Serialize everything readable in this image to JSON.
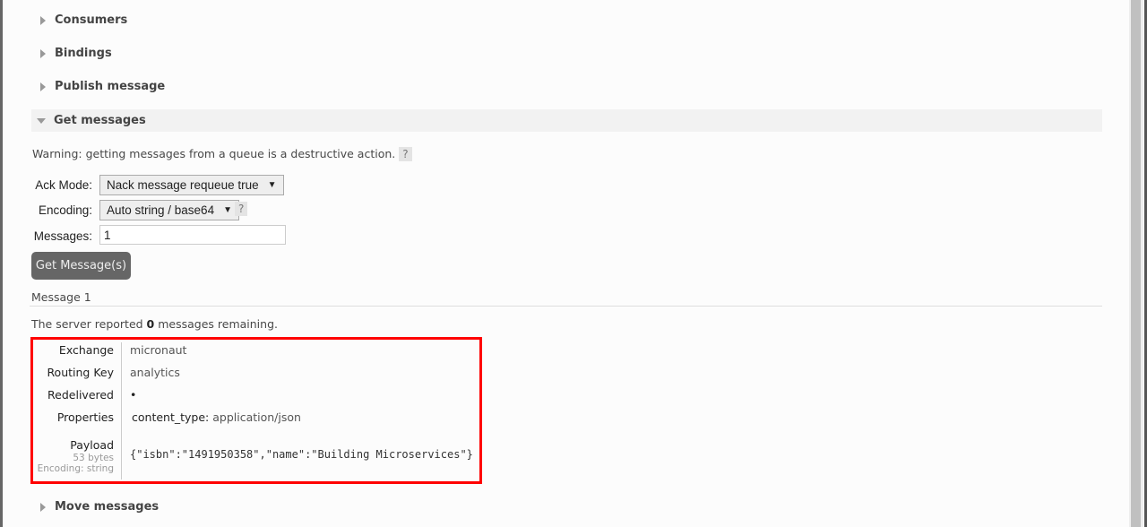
{
  "sections": {
    "consumers": "Consumers",
    "bindings": "Bindings",
    "publish": "Publish message",
    "get": "Get messages",
    "move": "Move messages"
  },
  "warning": "Warning: getting messages from a queue is a destructive action.",
  "help_label": "?",
  "form": {
    "ack_label": "Ack Mode:",
    "ack_value": "Nack message requeue true",
    "encoding_label": "Encoding:",
    "encoding_value": "Auto string / base64",
    "messages_label": "Messages:",
    "messages_value": "1",
    "submit": "Get Message(s)"
  },
  "result": {
    "title": "Message 1",
    "remaining_pre": "The server reported ",
    "remaining_count": "0",
    "remaining_post": " messages remaining.",
    "exchange_label": "Exchange",
    "exchange": "micronaut",
    "routing_label": "Routing Key",
    "routing": "analytics",
    "redelivered_label": "Redelivered",
    "redelivered": "•",
    "properties_label": "Properties",
    "prop_key": "content_type:",
    "prop_val": "application/json",
    "payload_label": "Payload",
    "payload_size": "53 bytes",
    "payload_encoding": "Encoding: string",
    "payload": "{\"isbn\":\"1491950358\",\"name\":\"Building Microservices\"}"
  },
  "colors": {
    "highlight": "#ff0000",
    "button": "#666666"
  }
}
